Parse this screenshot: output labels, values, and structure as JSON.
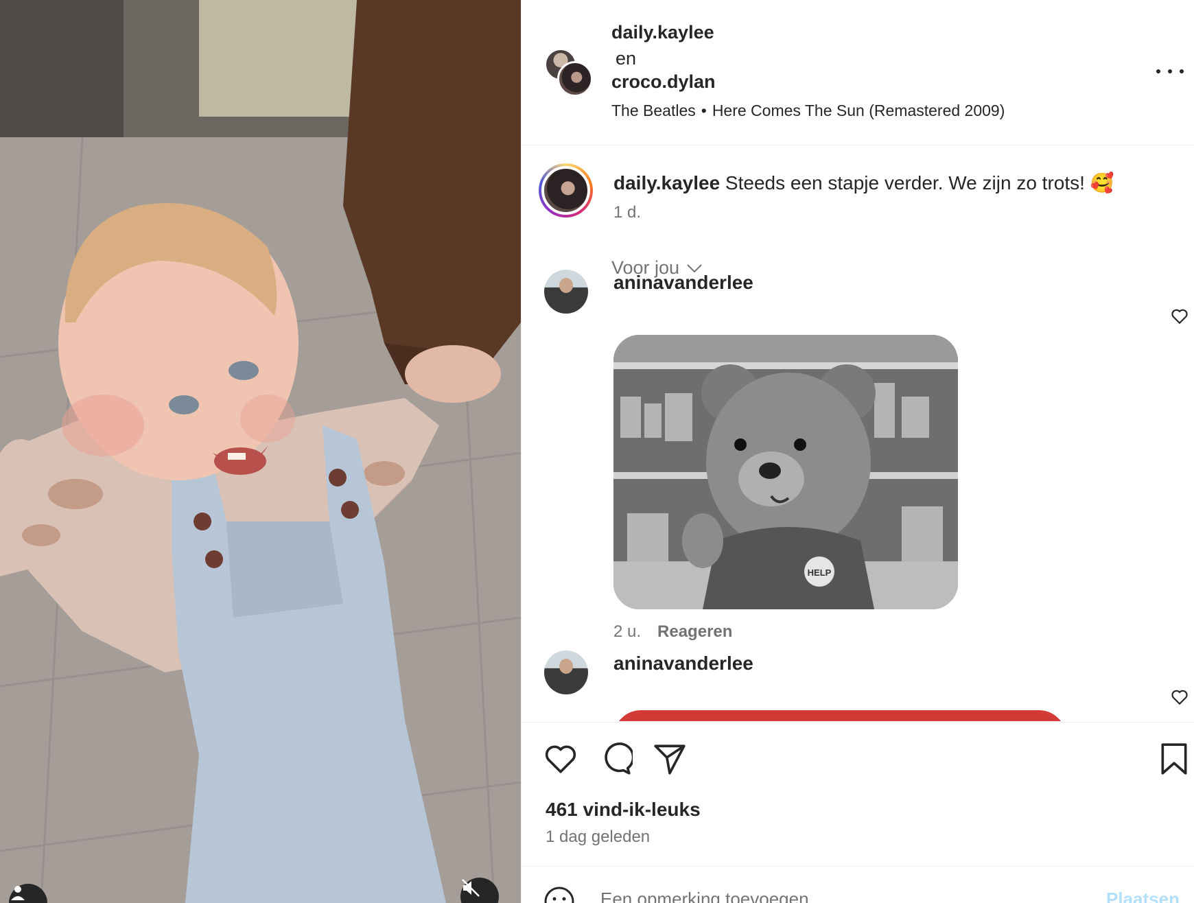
{
  "post": {
    "owner_primary": "daily.kaylee",
    "owner_separator": "en",
    "owner_secondary": "croco.dylan",
    "music_artist": "The Beatles",
    "music_separator": "•",
    "music_track": "Here Comes The Sun (Remastered 2009)",
    "more_icon": "more-horizontal-icon"
  },
  "caption": {
    "username": "daily.kaylee",
    "text": " Steeds een stapje verder. We zijn zo trots! 🥰",
    "time": "1 d."
  },
  "sort": {
    "label": "Voor jou"
  },
  "comments": [
    {
      "username": "aninavanderlee",
      "time": "2 u.",
      "reply_label": "Reageren",
      "gif_label": "HELP"
    },
    {
      "username": "aninavanderlee"
    }
  ],
  "actions": {
    "likes": "461 vind-ik-leuks",
    "date": "1 dag geleden"
  },
  "add_comment": {
    "placeholder": "Een opmerking toevoegen...",
    "post_label": "Plaatsen"
  },
  "colors": {
    "text": "#262626",
    "secondary": "#737373",
    "post_button_disabled": "#b2dffc",
    "divider": "#efefef"
  }
}
